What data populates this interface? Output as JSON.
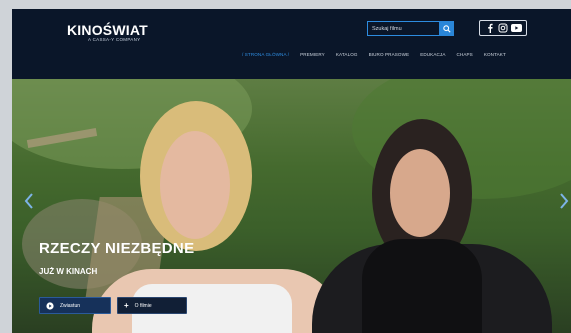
{
  "header": {
    "logo": "KINOŚWIAT",
    "logo_sub": "A CASSA-Y COMPANY",
    "search": {
      "placeholder": "Szukaj filmu"
    },
    "social": [
      "facebook-icon",
      "instagram-icon",
      "youtube-icon"
    ],
    "nav": [
      {
        "label": "/ STRONA GŁÓWNA /",
        "active": true
      },
      {
        "label": "PREMIERY"
      },
      {
        "label": "KATALOG"
      },
      {
        "label": "BIURO PRASOWE"
      },
      {
        "label": "EDUKACJA"
      },
      {
        "label": "CHAPS"
      },
      {
        "label": "KONTAKT"
      }
    ]
  },
  "hero": {
    "title": "RZECZY NIEZBĘDNE",
    "subtitle": "JUŻ W KINACH",
    "buttons": {
      "watch": "Zwiastun",
      "more": "O filmie"
    }
  },
  "colors": {
    "header_bg": "#0a1629",
    "accent": "#2f8fe4"
  }
}
